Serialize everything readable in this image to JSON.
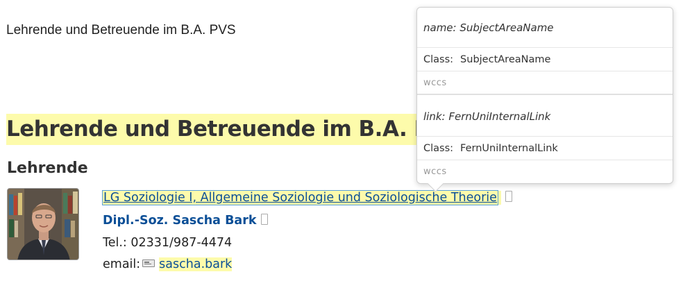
{
  "page": {
    "breadcrumb_title": "Lehrende und Betreuende im B.A. PVS",
    "heading": "Lehrende und Betreuende im B.A. PVS",
    "section_heading": "Lehrende"
  },
  "person": {
    "chair_link": "LG Soziologie I, Allgemeine Soziologie und Soziologische Theorie",
    "name_link": "Dipl.-Soz. Sascha Bark",
    "phone": "Tel.: 02331/987-4474",
    "email_label": "email:",
    "email_link": "sascha.bark"
  },
  "inspector": {
    "sections": [
      {
        "title": "name: SubjectAreaName",
        "class_key": "Class:",
        "class_value": "SubjectAreaName",
        "namespace": "wccs"
      },
      {
        "title": "link: FernUniInternalLink",
        "class_key": "Class:",
        "class_value": "FernUniInternalLink",
        "namespace": "wccs"
      }
    ]
  },
  "colors": {
    "highlight": "#fdfbab",
    "link": "#0b4f97",
    "heading_text": "#333333"
  },
  "icons": [
    "external-link-icon",
    "email-icon",
    "avatar-photo"
  ]
}
